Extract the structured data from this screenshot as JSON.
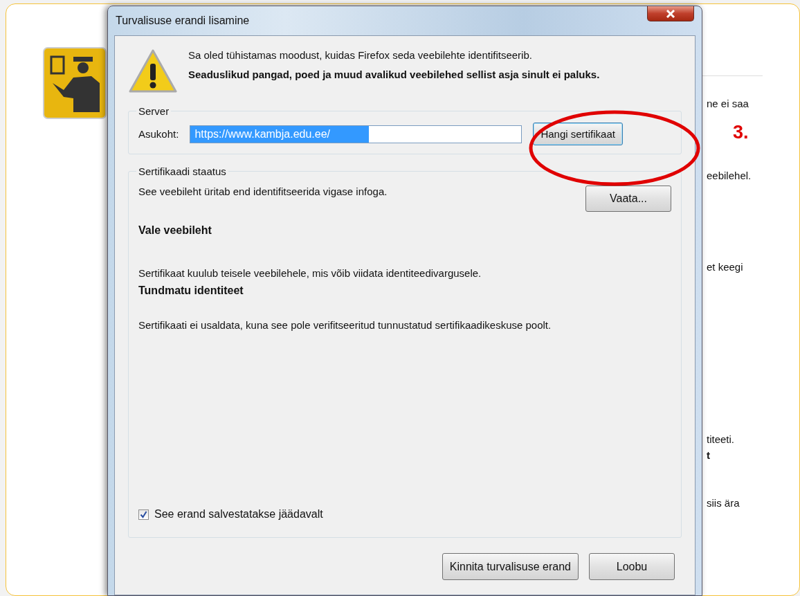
{
  "background_page": {
    "fragments": [
      {
        "text": "ne ei saa",
        "bold": false
      },
      {
        "text": "eebilehel.",
        "bold": false
      },
      {
        "text": "et keegi",
        "bold": false
      },
      {
        "text": "titeeti.",
        "bold": false
      },
      {
        "text": "t",
        "bold": true
      },
      {
        "text": "siis ära",
        "bold": false
      }
    ],
    "annotation": {
      "text": "3."
    }
  },
  "dialog": {
    "title": "Turvalisuse erandi lisamine",
    "warning": {
      "text": "Sa oled tühistamas moodust, kuidas Firefox seda veebilehte identifitseerib.",
      "bold_text": "Seaduslikud pangad, poed ja muud avalikud veebilehed sellist asja sinult ei paluks."
    },
    "server": {
      "legend": "Server",
      "label": "Asukoht:",
      "value": "https://www.kambja.edu.ee/",
      "value_selected": true,
      "button": "Hangi sertifikaat",
      "button_focused": true
    },
    "status": {
      "legend": "Sertifikaadi staatus",
      "summary": "See veebileht üritab end identifitseerida vigase infoga.",
      "view_button": "Vaata...",
      "problems": [
        {
          "title": "Vale veebileht",
          "description": "Sertifikaat kuulub teisele veebilehele, mis võib viidata identiteedivargusele."
        },
        {
          "title": "Tundmatu identiteet",
          "description": "Sertifikaati ei usaldata, kuna see pole verifitseeritud tunnustatud sertifikaadikeskuse poolt."
        }
      ]
    },
    "permanent": {
      "label": "See erand salvestatakse jäädavalt",
      "checked": true
    },
    "buttons": [
      {
        "label": "Kinnita turvalisuse erand",
        "kind": "confirm"
      },
      {
        "label": "Loobu",
        "kind": "cancel"
      }
    ]
  }
}
